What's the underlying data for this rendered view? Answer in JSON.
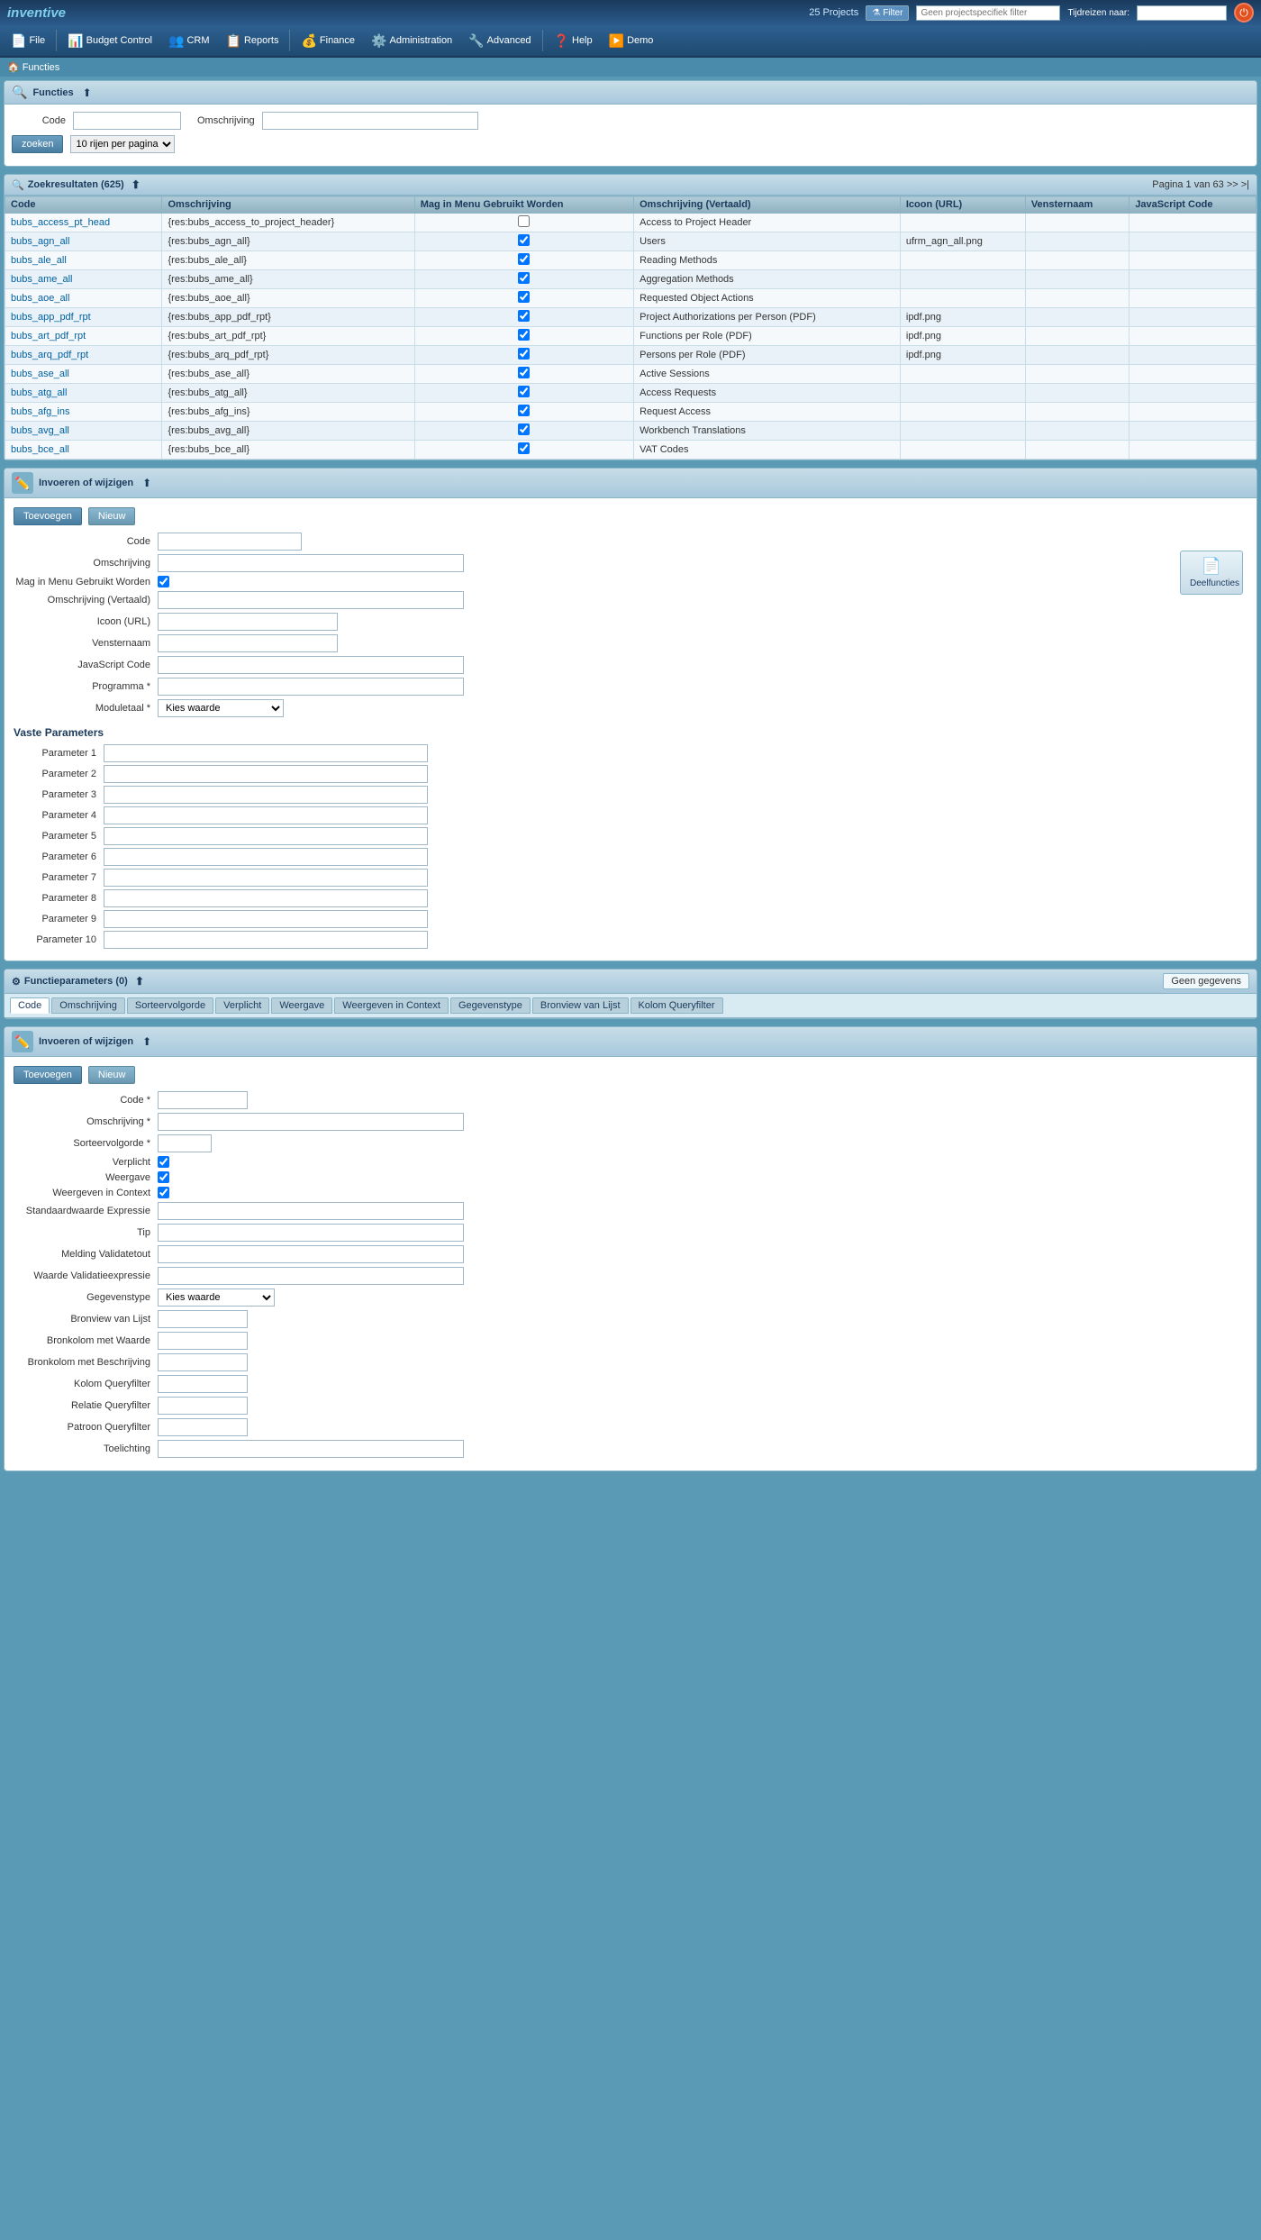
{
  "topbar": {
    "logo": "inventive",
    "projects_count": "25 Projects",
    "filter_label": "Filter",
    "filter_placeholder": "Geen projectspecifiek filter",
    "tijdreizen_label": "Tijdreizen naar:",
    "power_icon": "⏻"
  },
  "navbar": {
    "items": [
      {
        "id": "file",
        "label": "File",
        "icon": "📄"
      },
      {
        "id": "budget",
        "label": "Budget Control",
        "icon": "📊"
      },
      {
        "id": "crm",
        "label": "CRM",
        "icon": "👥"
      },
      {
        "id": "reports",
        "label": "Reports",
        "icon": "📋"
      },
      {
        "id": "finance",
        "label": "Finance",
        "icon": "💰"
      },
      {
        "id": "administration",
        "label": "Administration",
        "icon": "⚙️"
      },
      {
        "id": "advanced",
        "label": "Advanced",
        "icon": "🔧"
      },
      {
        "id": "help",
        "label": "Help",
        "icon": "❓"
      },
      {
        "id": "demo",
        "label": "Demo",
        "icon": "▶️"
      }
    ]
  },
  "breadcrumb": {
    "home_icon": "🏠",
    "label": "Functies"
  },
  "search_section": {
    "title": "Functies",
    "code_label": "Code",
    "omschrijving_label": "Omschrijving",
    "search_btn": "zoeken",
    "rows_label": "10 rijen per pagina"
  },
  "results_section": {
    "title": "Zoekresultaten (625)",
    "pagination": "Pagina 1 van 63 >> >|",
    "columns": [
      "Code",
      "Omschrijving",
      "Mag in Menu Gebruikt Worden",
      "Omschrijving (Vertaald)",
      "Icoon (URL)",
      "Vensternaam",
      "JavaScript Code"
    ],
    "rows": [
      {
        "code": "bubs_access_pt_head",
        "omschrijving": "{res:bubs_access_to_project_header}",
        "mag_menu": false,
        "omschrijving_vertaald": "Access to Project Header",
        "icoon": "",
        "vensternaam": "",
        "js_code": ""
      },
      {
        "code": "bubs_agn_all",
        "omschrijving": "{res:bubs_agn_all}",
        "mag_menu": true,
        "omschrijving_vertaald": "Users",
        "icoon": "ufrm_agn_all.png",
        "vensternaam": "",
        "js_code": ""
      },
      {
        "code": "bubs_ale_all",
        "omschrijving": "{res:bubs_ale_all}",
        "mag_menu": true,
        "omschrijving_vertaald": "Reading Methods",
        "icoon": "",
        "vensternaam": "",
        "js_code": ""
      },
      {
        "code": "bubs_ame_all",
        "omschrijving": "{res:bubs_ame_all}",
        "mag_menu": true,
        "omschrijving_vertaald": "Aggregation Methods",
        "icoon": "",
        "vensternaam": "",
        "js_code": ""
      },
      {
        "code": "bubs_aoe_all",
        "omschrijving": "{res:bubs_aoe_all}",
        "mag_menu": true,
        "omschrijving_vertaald": "Requested Object Actions",
        "icoon": "",
        "vensternaam": "",
        "js_code": ""
      },
      {
        "code": "bubs_app_pdf_rpt",
        "omschrijving": "{res:bubs_app_pdf_rpt}",
        "mag_menu": true,
        "omschrijving_vertaald": "Project Authorizations per Person (PDF)",
        "icoon": "ipdf.png",
        "vensternaam": "",
        "js_code": ""
      },
      {
        "code": "bubs_art_pdf_rpt",
        "omschrijving": "{res:bubs_art_pdf_rpt}",
        "mag_menu": true,
        "omschrijving_vertaald": "Functions per Role (PDF)",
        "icoon": "ipdf.png",
        "vensternaam": "",
        "js_code": ""
      },
      {
        "code": "bubs_arq_pdf_rpt",
        "omschrijving": "{res:bubs_arq_pdf_rpt}",
        "mag_menu": true,
        "omschrijving_vertaald": "Persons per Role (PDF)",
        "icoon": "ipdf.png",
        "vensternaam": "",
        "js_code": ""
      },
      {
        "code": "bubs_ase_all",
        "omschrijving": "{res:bubs_ase_all}",
        "mag_menu": true,
        "omschrijving_vertaald": "Active Sessions",
        "icoon": "",
        "vensternaam": "",
        "js_code": ""
      },
      {
        "code": "bubs_atg_all",
        "omschrijving": "{res:bubs_atg_all}",
        "mag_menu": true,
        "omschrijving_vertaald": "Access Requests",
        "icoon": "",
        "vensternaam": "",
        "js_code": ""
      },
      {
        "code": "bubs_afg_ins",
        "omschrijving": "{res:bubs_afg_ins}",
        "mag_menu": true,
        "omschrijving_vertaald": "Request Access",
        "icoon": "",
        "vensternaam": "",
        "js_code": ""
      },
      {
        "code": "bubs_avg_all",
        "omschrijving": "{res:bubs_avg_all}",
        "mag_menu": true,
        "omschrijving_vertaald": "Workbench Translations",
        "icoon": "",
        "vensternaam": "",
        "js_code": ""
      },
      {
        "code": "bubs_bce_all",
        "omschrijving": "{res:bubs_bce_all}",
        "mag_menu": true,
        "omschrijving_vertaald": "VAT Codes",
        "icoon": "",
        "vensternaam": "",
        "js_code": ""
      }
    ]
  },
  "invoeren_wijzigen": {
    "title": "Invoeren of wijzigen",
    "add_btn": "Toevoegen",
    "new_btn": "Nieuw",
    "deelfuncties_label": "Deelfuncties",
    "fields": {
      "code_label": "Code",
      "omschrijving_label": "Omschrijving",
      "mag_menu_label": "Mag in Menu Gebruikt Worden",
      "omschrijving_vertaald_label": "Omschrijving (Vertaald)",
      "icoon_url_label": "Icoon (URL)",
      "vensternaam_label": "Vensternaam",
      "javascript_code_label": "JavaScript Code",
      "programma_label": "Programma *",
      "moduletaal_label": "Moduletaal *",
      "moduletaal_value": "Kies waarde"
    },
    "vaste_parameters_title": "Vaste Parameters",
    "parameters": [
      "Parameter 1",
      "Parameter 2",
      "Parameter 3",
      "Parameter 4",
      "Parameter 5",
      "Parameter 6",
      "Parameter 7",
      "Parameter 8",
      "Parameter 9",
      "Parameter 10"
    ]
  },
  "functieparameters": {
    "title": "Functieparameters (0)",
    "geen_gegevens": "Geen gegevens",
    "tabs": [
      "Code",
      "Omschrijving",
      "Sorteervolgorde",
      "Verplicht",
      "Weergave",
      "Weergeven in Context",
      "Gegevenstype",
      "Bronview van Lijst",
      "Kolom Queryfilter"
    ]
  },
  "fp_invoeren": {
    "title": "Invoeren of wijzigen",
    "add_btn": "Toevoegen",
    "new_btn": "Nieuw",
    "fields": {
      "code_label": "Code *",
      "omschrijving_label": "Omschrijving *",
      "sorteervolgorde_label": "Sorteervolgorde *",
      "verplicht_label": "Verplicht",
      "weergave_label": "Weergave",
      "weergeven_context_label": "Weergeven in Context",
      "standaardwaarde_label": "Standaardwaarde Expressie",
      "tip_label": "Tip",
      "melding_validatietout_label": "Melding Validatetout",
      "waarde_validatieexpressie_label": "Waarde Validatieexpressie",
      "gegevenstype_label": "Gegevenstype",
      "gegevenstype_value": "Kies waarde",
      "bronview_lijst_label": "Bronview van Lijst",
      "bronkolom_waarde_label": "Bronkolom met Waarde",
      "bronkolom_beschrijving_label": "Bronkolom met Beschrijving",
      "kolom_queryfilter_label": "Kolom Queryfilter",
      "relatie_queryfilter_label": "Relatie Queryfilter",
      "patroon_queryfilter_label": "Patroon Queryfilter",
      "toelichting_label": "Toelichting"
    }
  },
  "colors": {
    "accent_blue": "#1a3a5c",
    "light_blue": "#5a9ab5",
    "header_bg": "#a8c8dc",
    "link_color": "#0060a0"
  }
}
